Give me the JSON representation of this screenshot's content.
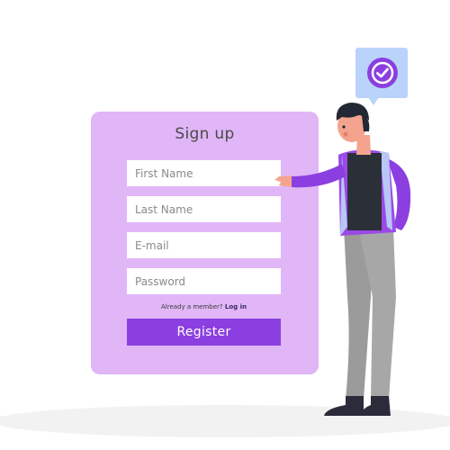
{
  "form": {
    "title": "Sign up",
    "first_name_placeholder": "First Name",
    "last_name_placeholder": "Last Name",
    "email_placeholder": "E-mail",
    "password_placeholder": "Password",
    "member_text": "Already a member?",
    "login_link": "Log in",
    "register_label": "Register"
  },
  "colors": {
    "card": "#e0b6f7",
    "accent": "#8b3fe0",
    "bubble": "#b9d3fb"
  },
  "icons": {
    "bubble": "checkmark-icon"
  }
}
